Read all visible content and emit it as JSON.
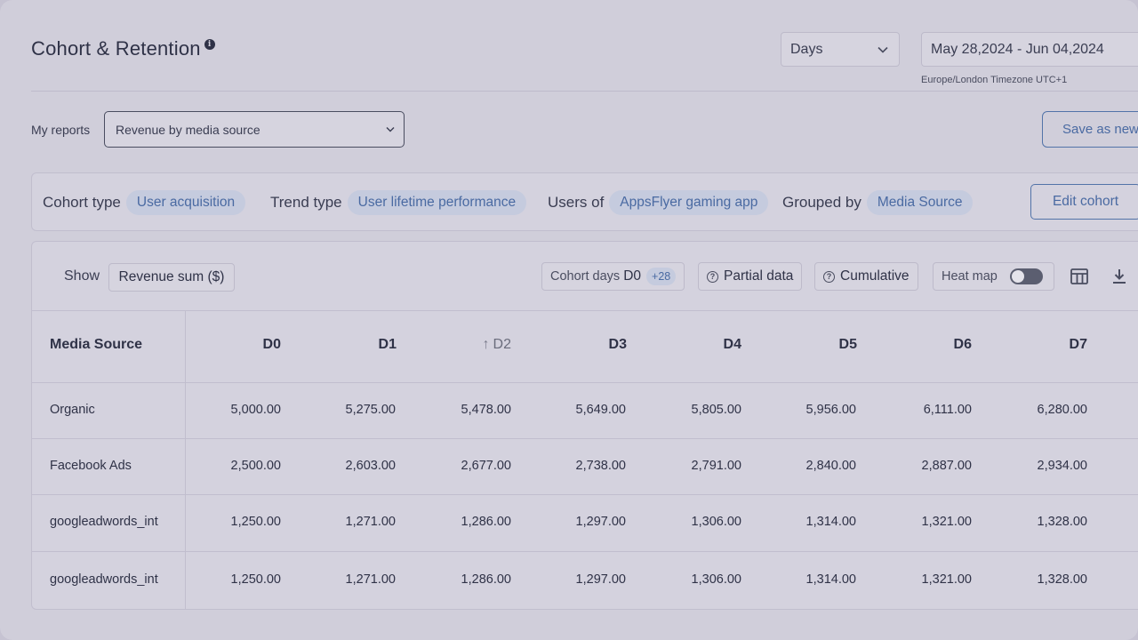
{
  "header": {
    "title": "Cohort & Retention",
    "period": "Days",
    "date_range": "May 28,2024 - Jun 04,2024",
    "timezone": "Europe/London Timezone UTC+1"
  },
  "reports": {
    "label": "My reports",
    "selected": "Revenue by media source",
    "save_label": "Save as new"
  },
  "cohort": {
    "type_label": "Cohort type",
    "type_value": "User acquisition",
    "trend_label": "Trend type",
    "trend_value": "User lifetime performance",
    "users_label": "Users of",
    "users_value": "AppsFlyer gaming app",
    "group_label": "Grouped by",
    "group_value": "Media Source",
    "edit_label": "Edit cohort"
  },
  "toolbar": {
    "show_label": "Show",
    "metric": "Revenue sum ($)",
    "cohort_days_label": "Cohort days",
    "cohort_days_value": "D0",
    "cohort_days_extra": "+28",
    "partial_label": "Partial data",
    "cumulative_label": "Cumulative",
    "heatmap_label": "Heat map"
  },
  "table": {
    "first_header": "Media Source",
    "columns": [
      "D0",
      "D1",
      "D2",
      "D3",
      "D4",
      "D5",
      "D6",
      "D7"
    ],
    "rows": [
      {
        "name": "Organic",
        "values": [
          "5,000.00",
          "5,275.00",
          "5,478.00",
          "5,649.00",
          "5,805.00",
          "5,956.00",
          "6,111.00",
          "6,280.00"
        ]
      },
      {
        "name": "Facebook Ads",
        "values": [
          "2,500.00",
          "2,603.00",
          "2,677.00",
          "2,738.00",
          "2,791.00",
          "2,840.00",
          "2,887.00",
          "2,934.00"
        ]
      },
      {
        "name": "googleadwords_int",
        "values": [
          "1,250.00",
          "1,271.00",
          "1,286.00",
          "1,297.00",
          "1,306.00",
          "1,314.00",
          "1,321.00",
          "1,328.00"
        ]
      },
      {
        "name": "googleadwords_int",
        "values": [
          "1,250.00",
          "1,271.00",
          "1,286.00",
          "1,297.00",
          "1,306.00",
          "1,314.00",
          "1,321.00",
          "1,328.00"
        ]
      }
    ]
  }
}
